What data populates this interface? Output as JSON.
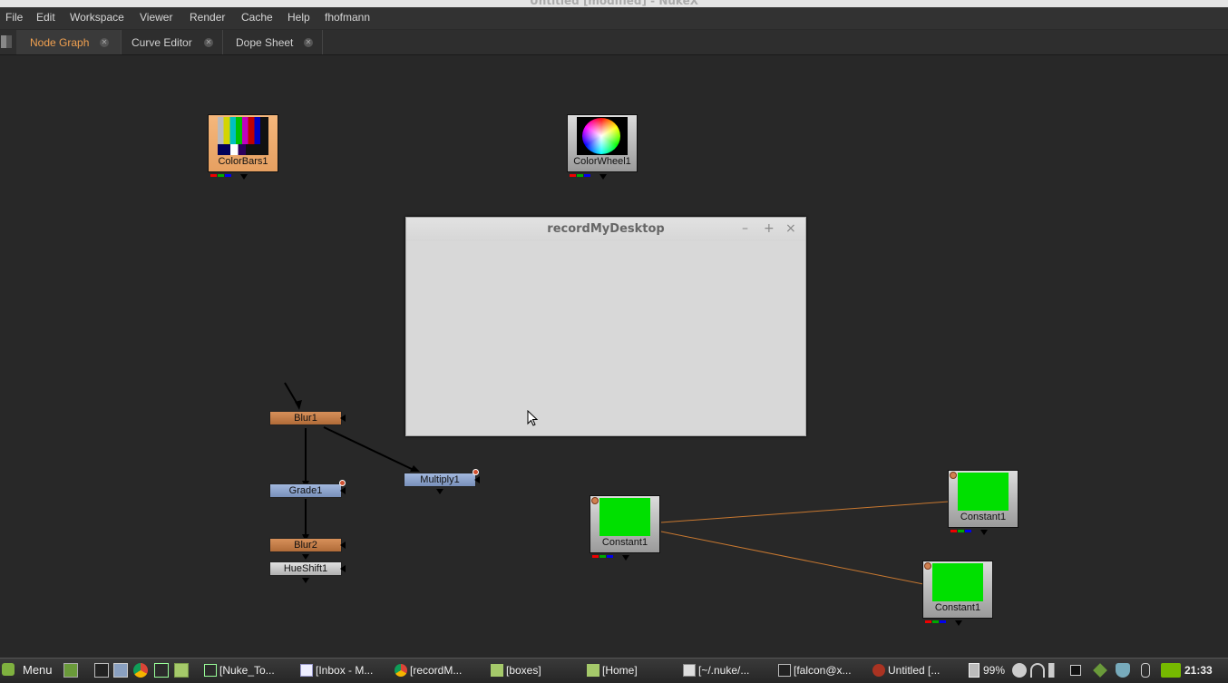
{
  "window": {
    "title": "Untitled [modified] - NukeX"
  },
  "menubar": {
    "items": [
      "File",
      "Edit",
      "Workspace",
      "Viewer",
      "Render",
      "Cache",
      "Help",
      "fhofmann"
    ]
  },
  "tabs": [
    {
      "label": "Node Graph",
      "active": true
    },
    {
      "label": "Curve Editor",
      "active": false
    },
    {
      "label": "Dope Sheet",
      "active": false
    }
  ],
  "nodes": {
    "colorbars": "ColorBars1",
    "colorwheel": "ColorWheel1",
    "blur1": "Blur1",
    "grade1": "Grade1",
    "multiply1": "Multiply1",
    "blur2": "Blur2",
    "hueshift1": "HueShift1",
    "constant_a": "Constant1",
    "constant_b": "Constant1",
    "constant_c": "Constant1"
  },
  "dialog": {
    "title": "recordMyDesktop",
    "minimize": "–",
    "maximize": "+",
    "close": "×"
  },
  "taskbar": {
    "menu_label": "Menu",
    "tasks": [
      "[Nuke_To...",
      "[Inbox - M...",
      "[recordM...",
      "[boxes]",
      "[Home]",
      "[~/.nuke/...",
      "[falcon@x...",
      "Untitled [..."
    ],
    "battery": "99%",
    "clock": "21:33"
  },
  "colors": {
    "accent_tab": "#f0a050",
    "constant_green": "#00e000",
    "link_orange": "#c87830"
  }
}
